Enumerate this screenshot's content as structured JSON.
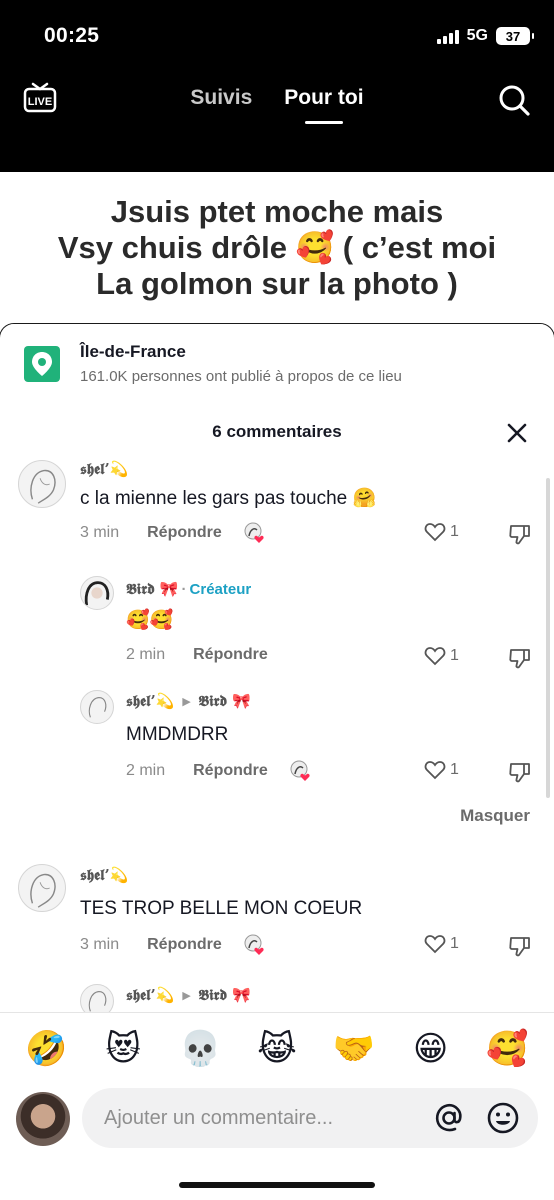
{
  "status_bar": {
    "time": "00:25",
    "network": "5G",
    "battery": "37"
  },
  "nav": {
    "live_icon": "live-tv-icon",
    "tabs": [
      {
        "label": "Suivis"
      },
      {
        "label": "Pour toi"
      }
    ],
    "active_tab": "Pour toi",
    "search_icon": "search-icon"
  },
  "caption": {
    "lines": [
      "Jsuis ptet moche mais",
      "Vsy chuis drôle 🥰 ( c’est moi",
      "La golmon sur la photo )"
    ]
  },
  "location": {
    "icon": "location-pin-icon",
    "title": "Île-de-France",
    "subtitle": "161.0K personnes ont publié à propos de ce lieu"
  },
  "comments_header": {
    "title": "6 commentaires",
    "close_icon": "close-icon"
  },
  "comments": [
    {
      "user": "𝖘𝖍𝖊𝖑’💫",
      "text": "c la mienne les gars pas touche 🤗",
      "time": "3 min",
      "reply_label": "Répondre",
      "likes": "1"
    },
    {
      "user": "𝕭𝖎𝖗𝖉 🎀",
      "badge": "Créateur",
      "text": "🥰🥰",
      "time": "2 min",
      "reply_label": "Répondre",
      "likes": "1"
    },
    {
      "user": "𝖘𝖍𝖊𝖑’💫",
      "reply_to": "𝕭𝖎𝖗𝖉 🎀",
      "text": "MMDMDRR",
      "time": "2 min",
      "reply_label": "Répondre",
      "likes": "1"
    },
    {
      "user": "𝖘𝖍𝖊𝖑’💫",
      "text": "TES TROP BELLE MON COEUR",
      "time": "3 min",
      "reply_label": "Répondre",
      "likes": "1"
    },
    {
      "user": "𝖘𝖍𝖊𝖑’💫",
      "reply_to": "𝕭𝖎𝖗𝖉 🎀"
    }
  ],
  "masquer_label": "Masquer",
  "emoji_bar": [
    "🤣",
    "😻",
    "💀",
    "😹",
    "🤝",
    "😁",
    "🥰"
  ],
  "comment_input": {
    "placeholder": "Ajouter un commentaire...",
    "at_icon": "at-icon",
    "emoji_icon": "smile-icon"
  }
}
